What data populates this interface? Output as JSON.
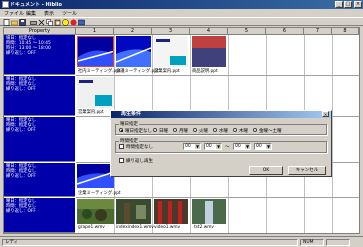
{
  "window": {
    "title": "ドキュメント - Hiblio",
    "min": "_",
    "max": "□",
    "close": "×"
  },
  "menu": [
    "ファイル",
    "編集",
    "表示",
    "ツール"
  ],
  "toolbar": [
    "new-icon",
    "open-icon",
    "save-icon",
    "print-icon",
    "cut-icon",
    "copy-icon",
    "paste-icon",
    "help-icon",
    "stop-icon",
    "search-icon"
  ],
  "grid": {
    "header_property": "Property",
    "columns": [
      "1",
      "2",
      "3",
      "4",
      "5",
      "6",
      "7",
      "8"
    ],
    "rows": [
      {
        "property": "場日：指定なし\n時間：10:45 ～ 10:45\n時分：13:00 ～ 18:00\n繰り返し：OFF",
        "files": [
          "社内ミーティング.ppt",
          "会議ミーティング.ppt",
          "営業案内.ppt",
          "商品説明.ppt"
        ]
      },
      {
        "property": "曜日：指定なし\n時間：指定なし\n繰り返し：OFF",
        "files": [
          "営業案内.ppt",
          "",
          "",
          ""
        ]
      },
      {
        "property": "曜日：指定なし\n時間：指定なし\n繰り返し：OFF",
        "files": [
          "",
          "",
          "",
          ""
        ]
      },
      {
        "property": "曜日：指定なし\n時間：指定なし\n繰り返し：OFF",
        "files": [
          "企業ミーティング.ppt",
          "",
          "",
          ""
        ]
      },
      {
        "property": "曜日：指定なし\n時間：指定なし\n繰り返し：OFF",
        "files": [
          "grape1.wmv",
          "indexindex1.wmv",
          "video1.wmv",
          "tst2.wmv"
        ]
      }
    ]
  },
  "dialog": {
    "title": "再生条件",
    "weekday_group": "曜日指定",
    "weekday_options": [
      "曜日指定なし",
      "日曜",
      "月曜",
      "火曜",
      "水曜",
      "木曜",
      "金曜～土曜"
    ],
    "weekday_selected": 0,
    "time_group": "時間指定",
    "time_check": "時間指定なし",
    "time_start_h": "00",
    "time_start_m": "00",
    "time_sep": "～",
    "time_end_h": "00",
    "time_end_m": "00",
    "repeat_label": "繰り返し再生",
    "ok": "OK",
    "cancel": "キャンセル"
  },
  "status": {
    "left": "レディ",
    "right1": "NUM",
    "right2": ""
  }
}
